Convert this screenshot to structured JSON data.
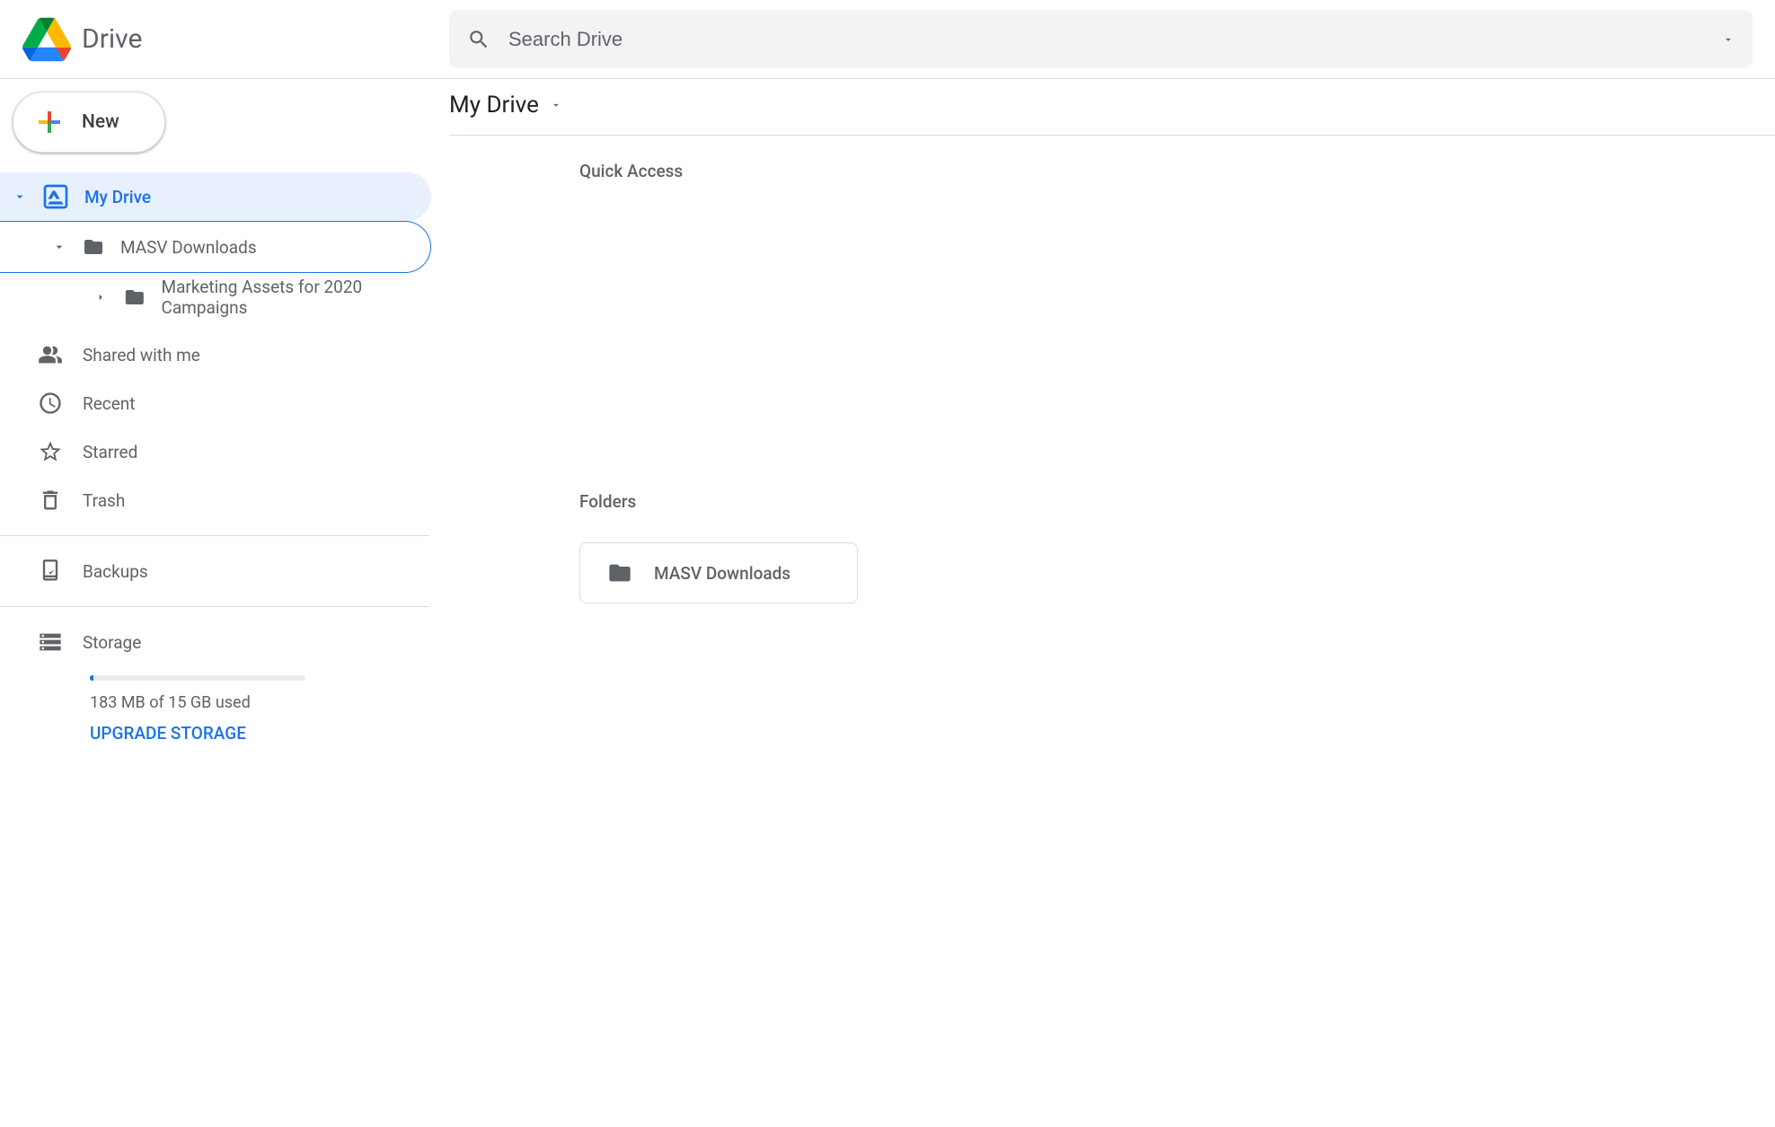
{
  "app": {
    "name": "Drive"
  },
  "search": {
    "placeholder": "Search Drive"
  },
  "new_button": {
    "label": "New"
  },
  "tree": {
    "root": {
      "label": "My Drive"
    },
    "level1": {
      "label": "MASV Downloads"
    },
    "level2": {
      "label": "Marketing Assets for 2020 Campaigns"
    }
  },
  "nav": {
    "shared": "Shared with me",
    "recent": "Recent",
    "starred": "Starred",
    "trash": "Trash",
    "backups": "Backups",
    "storage": "Storage"
  },
  "storage": {
    "used_text": "183 MB of 15 GB used",
    "upgrade": "UPGRADE STORAGE"
  },
  "main": {
    "breadcrumb": "My Drive",
    "quick_access_label": "Quick Access",
    "folders_label": "Folders",
    "folders": [
      {
        "name": "MASV Downloads"
      }
    ]
  }
}
